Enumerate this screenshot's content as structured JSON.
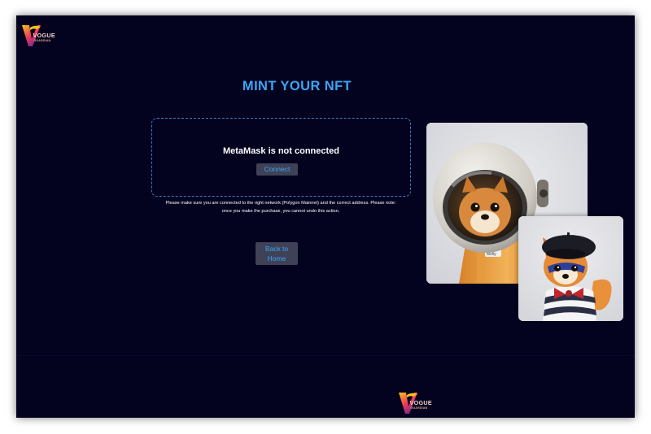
{
  "brand": {
    "name": "VOGUE",
    "tagline": "GUARDIAN"
  },
  "mint": {
    "title": "MINT YOUR NFT",
    "status_text": "MetaMask is not connected",
    "connect_label": "Connect",
    "notice_lines": [
      "Please make sure you are connected to the right network (Polygon Mainnet) and the correct address. Please note:",
      "once you make the purchase, you cannot undo this action."
    ],
    "back_label_lines": [
      "Back to",
      "Home"
    ]
  },
  "gallery": {
    "astronaut_tag": "Molly"
  },
  "colors": {
    "page_background": "#03021f",
    "accent": "#3aa6f5",
    "button_background": "#3f4156",
    "dashed_border": "#3f7fc6",
    "logo_gradient": [
      "#f7c41e",
      "#ee3a5b",
      "#7b2a8a"
    ]
  },
  "icons": {
    "brand": "vogue-guardian-logo-icon"
  }
}
